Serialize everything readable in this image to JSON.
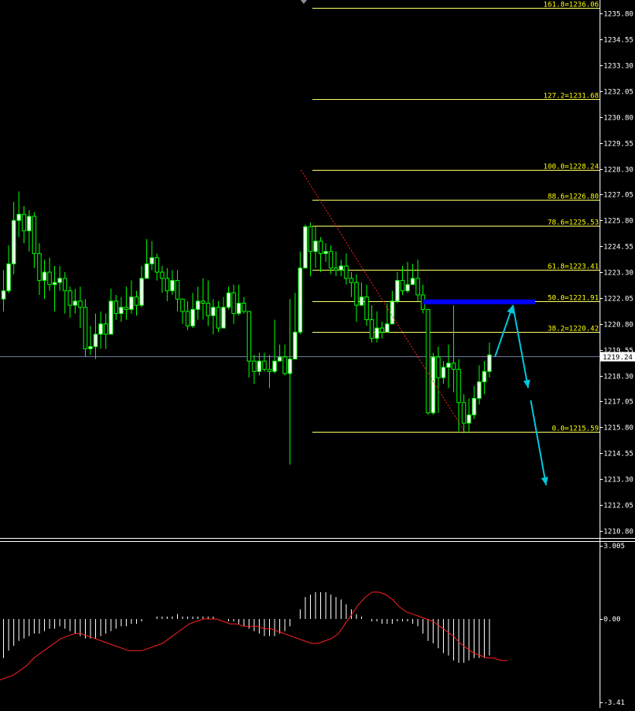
{
  "colors": {
    "background": "#000000",
    "frame": "#ffffff",
    "bull_body": "#ffffff",
    "bear_body": "#000000",
    "wick": "#00ff00",
    "fib_line": "#ffff66",
    "fib_label": "#ffff00",
    "price_line": "#6f7a99",
    "price_tag_bg": "#ffffff",
    "price_tag_text": "#000000",
    "trend_line": "#ff2020",
    "zone": "#0000ff",
    "projection": "#00c8dc",
    "histogram": "#ffffff",
    "signal": "#ff2020",
    "axis_text": "#ffffff"
  },
  "price_axis": {
    "ylim": [
      1210.45,
      1236.45
    ],
    "ticks": [
      "1235.80",
      "1234.55",
      "1233.30",
      "1232.05",
      "1230.80",
      "1229.55",
      "1228.30",
      "1227.05",
      "1225.80",
      "1224.55",
      "1223.30",
      "1222.05",
      "1220.80",
      "1219.55",
      "1218.30",
      "1217.05",
      "1215.80",
      "1214.55",
      "1213.30",
      "1212.05",
      "1210.80"
    ],
    "current_price": "1219.24"
  },
  "chart_data": [
    {
      "type": "candlestick",
      "series_candles": [
        [
          1222.0,
          1222.4,
          1223.4,
          1221.4
        ],
        [
          1222.4,
          1223.7,
          1224.6,
          1222.3
        ],
        [
          1223.7,
          1225.8,
          1226.7,
          1223.2
        ],
        [
          1225.8,
          1226.1,
          1227.2,
          1225.0
        ],
        [
          1226.1,
          1225.3,
          1226.5,
          1224.7
        ],
        [
          1225.3,
          1226.0,
          1226.3,
          1224.3
        ],
        [
          1226.0,
          1224.2,
          1226.2,
          1223.5
        ],
        [
          1224.2,
          1222.9,
          1224.7,
          1222.2
        ],
        [
          1222.9,
          1223.3,
          1223.9,
          1222.0
        ],
        [
          1223.3,
          1222.7,
          1224.0,
          1222.4
        ],
        [
          1222.7,
          1222.8,
          1223.6,
          1221.4
        ],
        [
          1222.8,
          1223.0,
          1223.6,
          1222.4
        ],
        [
          1223.0,
          1222.4,
          1223.3,
          1221.3
        ],
        [
          1222.4,
          1221.7,
          1222.6,
          1221.1
        ],
        [
          1221.7,
          1221.9,
          1222.5,
          1221.3
        ],
        [
          1221.9,
          1221.6,
          1222.6,
          1220.6
        ],
        [
          1221.6,
          1219.6,
          1222.0,
          1219.2
        ],
        [
          1219.6,
          1219.7,
          1220.7,
          1219.3
        ],
        [
          1219.7,
          1220.3,
          1221.3,
          1219.1
        ],
        [
          1220.3,
          1220.8,
          1221.4,
          1219.6
        ],
        [
          1220.8,
          1220.3,
          1221.3,
          1219.6
        ],
        [
          1220.3,
          1221.9,
          1222.5,
          1220.3
        ],
        [
          1221.9,
          1221.3,
          1222.2,
          1221.0
        ],
        [
          1221.3,
          1221.6,
          1222.1,
          1220.9
        ],
        [
          1221.6,
          1221.5,
          1222.6,
          1221.0
        ],
        [
          1221.5,
          1222.1,
          1222.9,
          1221.3
        ],
        [
          1222.1,
          1221.7,
          1222.4,
          1221.2
        ],
        [
          1221.7,
          1223.0,
          1223.6,
          1221.6
        ],
        [
          1223.0,
          1223.7,
          1224.9,
          1223.0
        ],
        [
          1223.7,
          1224.0,
          1224.8,
          1223.4
        ],
        [
          1224.0,
          1223.3,
          1224.2,
          1222.9
        ],
        [
          1223.3,
          1223.0,
          1223.6,
          1222.3
        ],
        [
          1223.0,
          1222.4,
          1223.5,
          1221.9
        ],
        [
          1222.4,
          1222.9,
          1223.4,
          1222.2
        ],
        [
          1222.9,
          1222.0,
          1223.4,
          1221.4
        ],
        [
          1222.0,
          1221.4,
          1221.7,
          1220.8
        ],
        [
          1221.4,
          1220.7,
          1221.9,
          1220.5
        ],
        [
          1220.7,
          1221.5,
          1222.3,
          1220.6
        ],
        [
          1221.5,
          1221.9,
          1222.6,
          1221.0
        ],
        [
          1221.9,
          1221.8,
          1223.0,
          1221.0
        ],
        [
          1221.8,
          1221.2,
          1222.9,
          1220.7
        ],
        [
          1221.2,
          1221.6,
          1222.0,
          1220.3
        ],
        [
          1221.6,
          1220.6,
          1221.9,
          1220.4
        ],
        [
          1220.6,
          1221.6,
          1222.1,
          1220.6
        ],
        [
          1221.6,
          1222.3,
          1222.6,
          1221.5
        ],
        [
          1222.3,
          1221.3,
          1222.7,
          1220.8
        ],
        [
          1221.3,
          1221.8,
          1222.7,
          1221.2
        ],
        [
          1221.8,
          1221.4,
          1222.1,
          1221.3
        ],
        [
          1221.4,
          1219.0,
          1221.4,
          1218.2
        ],
        [
          1219.0,
          1218.5,
          1219.3,
          1217.9
        ],
        [
          1218.5,
          1219.0,
          1219.4,
          1218.3
        ],
        [
          1219.0,
          1218.6,
          1219.4,
          1218.5
        ],
        [
          1218.6,
          1218.5,
          1219.3,
          1217.7
        ],
        [
          1218.5,
          1219.0,
          1221.0,
          1218.4
        ],
        [
          1219.0,
          1219.2,
          1219.8,
          1219.0
        ],
        [
          1219.2,
          1218.4,
          1219.8,
          1218.3
        ],
        [
          1218.4,
          1219.1,
          1222.0,
          1214.0
        ],
        [
          1219.1,
          1220.4,
          1222.3,
          1219.2
        ],
        [
          1220.4,
          1223.5,
          1224.3,
          1220.3
        ],
        [
          1223.5,
          1225.5,
          1225.6,
          1223.5
        ],
        [
          1225.5,
          1224.3,
          1225.7,
          1223.1
        ],
        [
          1224.3,
          1224.8,
          1225.5,
          1223.5
        ],
        [
          1224.8,
          1224.2,
          1225.0,
          1223.3
        ],
        [
          1224.2,
          1224.3,
          1224.7,
          1223.8
        ],
        [
          1224.3,
          1223.5,
          1224.6,
          1223.2
        ],
        [
          1223.5,
          1223.4,
          1224.3,
          1223.1
        ],
        [
          1223.4,
          1223.6,
          1223.9,
          1223.1
        ],
        [
          1223.6,
          1223.0,
          1224.2,
          1222.7
        ],
        [
          1223.0,
          1222.8,
          1223.3,
          1222.1
        ],
        [
          1222.8,
          1221.7,
          1223.2,
          1220.9
        ],
        [
          1221.7,
          1222.1,
          1222.8,
          1221.7
        ],
        [
          1222.1,
          1221.0,
          1222.7,
          1220.7
        ],
        [
          1221.0,
          1220.1,
          1221.7,
          1219.9
        ],
        [
          1220.1,
          1220.6,
          1221.4,
          1219.9
        ],
        [
          1220.6,
          1220.4,
          1220.9,
          1220.1
        ],
        [
          1220.4,
          1220.8,
          1221.8,
          1220.4
        ],
        [
          1220.8,
          1221.9,
          1222.4,
          1220.8
        ],
        [
          1221.9,
          1222.9,
          1223.3,
          1221.8
        ],
        [
          1222.9,
          1222.4,
          1223.6,
          1222.2
        ],
        [
          1222.4,
          1222.7,
          1223.8,
          1222.3
        ],
        [
          1222.7,
          1223.0,
          1223.7,
          1222.7
        ],
        [
          1223.0,
          1222.2,
          1223.9,
          1221.9
        ],
        [
          1222.2,
          1221.5,
          1222.7,
          1221.3
        ],
        [
          1221.5,
          1216.5,
          1221.5,
          1216.4
        ],
        [
          1216.5,
          1219.2,
          1219.4,
          1216.4
        ],
        [
          1219.2,
          1218.2,
          1219.7,
          1216.5
        ],
        [
          1218.2,
          1218.7,
          1219.0,
          1217.9
        ],
        [
          1218.7,
          1218.9,
          1219.8,
          1217.7
        ],
        [
          1218.9,
          1218.6,
          1221.7,
          1217.5
        ],
        [
          1218.6,
          1217.0,
          1219.1,
          1215.6
        ],
        [
          1217.0,
          1216.0,
          1217.4,
          1215.5
        ],
        [
          1216.0,
          1216.4,
          1217.2,
          1215.6
        ],
        [
          1216.4,
          1217.2,
          1217.8,
          1216.2
        ],
        [
          1217.2,
          1218.0,
          1218.8,
          1216.9
        ],
        [
          1218.0,
          1218.5,
          1219.0,
          1217.4
        ],
        [
          1218.5,
          1219.3,
          1219.9,
          1218.2
        ]
      ],
      "fibonacci": [
        {
          "label": "161.8=1236.06",
          "value": 1236.06
        },
        {
          "label": "127.2=1231.68",
          "value": 1231.68
        },
        {
          "label": "100.0=1228.24",
          "value": 1228.24
        },
        {
          "label": "88.6=1226.80",
          "value": 1226.8
        },
        {
          "label": "78.6=1225.53",
          "value": 1225.53
        },
        {
          "label": "61.8=1223.41",
          "value": 1223.41
        },
        {
          "label": "50.0=1221.91",
          "value": 1221.91
        },
        {
          "label": "38.2=1220.42",
          "value": 1220.42
        },
        {
          "label": "0.0=1215.59",
          "value": 1215.59
        }
      ],
      "trendline": {
        "from": [
          58,
          1228.24
        ],
        "to": [
          90,
          1215.59
        ]
      },
      "resistance_zone": {
        "from_bar": 82,
        "to_price_high": 1221.98,
        "to_price_low": 1221.75
      },
      "projection_path": [
        [
          96,
          1219.2
        ],
        [
          99.5,
          1221.7
        ],
        [
          102.5,
          1217.7
        ],
        [
          103,
          1217.1
        ],
        [
          106,
          1213.0
        ]
      ]
    },
    {
      "type": "histogram_oscillator",
      "ylim": [
        -3.41,
        3.005
      ],
      "tick_labels": [
        "3.005",
        "0.00",
        "-3.41"
      ],
      "histogram": [
        -1.6,
        -1.3,
        -1.1,
        -0.9,
        -0.8,
        -0.7,
        -0.6,
        -0.6,
        -0.5,
        -0.4,
        -0.4,
        -0.3,
        -0.4,
        -0.5,
        -0.6,
        -0.7,
        -0.8,
        -0.8,
        -0.8,
        -0.7,
        -0.6,
        -0.5,
        -0.4,
        -0.3,
        -0.3,
        -0.2,
        -0.2,
        -0.1,
        0.0,
        0.0,
        0.1,
        0.1,
        0.1,
        0.1,
        0.2,
        0.1,
        0.1,
        0.1,
        0.1,
        0.1,
        0.1,
        0.1,
        0.0,
        0.0,
        -0.1,
        -0.1,
        -0.2,
        -0.3,
        -0.4,
        -0.5,
        -0.6,
        -0.7,
        -0.7,
        -0.7,
        -0.6,
        -0.5,
        -0.3,
        0.0,
        0.4,
        0.9,
        1.0,
        1.1,
        1.1,
        1.1,
        1.0,
        0.9,
        0.8,
        0.6,
        0.4,
        0.2,
        0.1,
        0.0,
        -0.1,
        -0.1,
        -0.2,
        -0.2,
        -0.2,
        -0.1,
        -0.1,
        -0.1,
        -0.2,
        -0.3,
        -0.6,
        -0.9,
        -1.0,
        -1.2,
        -1.4,
        -1.5,
        -1.7,
        -1.8,
        -1.8,
        -1.7,
        -1.6,
        -1.6,
        -1.6,
        -1.5
      ],
      "signal": [
        -2.5,
        -2.4,
        -2.3,
        -2.1,
        -1.9,
        -1.6,
        -1.4,
        -1.2,
        -1.0,
        -0.8,
        -0.7,
        -0.6,
        -0.6,
        -0.7,
        -0.8,
        -0.9,
        -1.0,
        -1.1,
        -1.2,
        -1.3,
        -1.3,
        -1.3,
        -1.2,
        -1.1,
        -1.0,
        -0.8,
        -0.6,
        -0.4,
        -0.2,
        -0.1,
        0.0,
        0.0,
        0.0,
        -0.1,
        -0.2,
        -0.2,
        -0.3,
        -0.3,
        -0.3,
        -0.4,
        -0.4,
        -0.5,
        -0.6,
        -0.7,
        -0.8,
        -0.9,
        -1.0,
        -1.0,
        -0.9,
        -0.8,
        -0.6,
        -0.2,
        0.2,
        0.6,
        0.9,
        1.1,
        1.1,
        1.0,
        0.8,
        0.5,
        0.3,
        0.2,
        0.1,
        0.0,
        -0.1,
        -0.3,
        -0.5,
        -0.7,
        -1.0,
        -1.2,
        -1.4,
        -1.5,
        -1.6,
        -1.6,
        -1.7,
        -1.7
      ],
      "series": [
        {
          "values_ref": "histogram"
        },
        {
          "values_ref": "signal"
        }
      ]
    }
  ]
}
